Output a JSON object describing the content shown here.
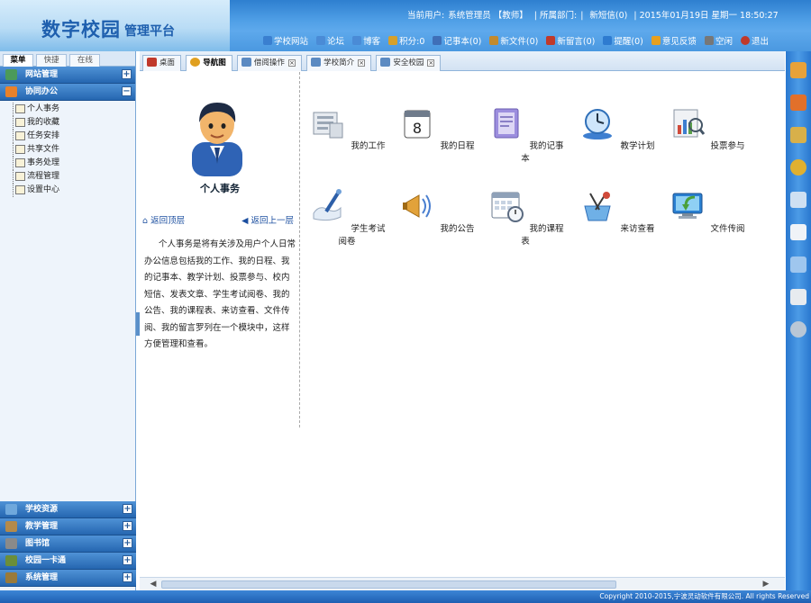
{
  "app": {
    "title_main": "数字校园",
    "title_sub": "管理平台"
  },
  "topinfo": {
    "user_label": "当前用户:",
    "user_value": "系统管理员 【教师】",
    "dept_label": "| 所属部门:",
    "dept_value": "|",
    "sms": "新短信(0)",
    "date": "| 2015年01月19日 星期一 18:50:27"
  },
  "toolbar": [
    {
      "label": "学校网站",
      "icon": "globe-icon",
      "color": "#3a7fd0"
    },
    {
      "label": "论坛",
      "icon": "forum-icon",
      "color": "#4a8bd6"
    },
    {
      "label": "博客",
      "icon": "blog-icon",
      "color": "#4a8bd6"
    },
    {
      "label": "积分:0",
      "icon": "points-icon",
      "color": "#d6a02a"
    },
    {
      "label": "记事本(0)",
      "icon": "notebook-icon",
      "color": "#3f6fb8"
    },
    {
      "label": "新文件(0)",
      "icon": "file-icon",
      "color": "#c28a2e"
    },
    {
      "label": "新留言(0)",
      "icon": "message-icon",
      "color": "#c0392b"
    },
    {
      "label": "提醒(0)",
      "icon": "reminder-icon",
      "color": "#2e7bd0"
    },
    {
      "label": "意见反馈",
      "icon": "feedback-icon",
      "color": "#e8a020"
    },
    {
      "label": "空闲",
      "icon": "status-icon",
      "color": "#777777"
    },
    {
      "label": "退出",
      "icon": "exit-icon",
      "color": "#c0392b"
    }
  ],
  "left_tabs": [
    "菜单",
    "快捷",
    "在线"
  ],
  "left_sections_top": [
    {
      "label": "网站管理",
      "icon": "website-icon",
      "color": "#4b9a5a",
      "toggle": "+"
    },
    {
      "label": "协同办公",
      "icon": "rss-icon",
      "color": "#e8812a",
      "toggle": "−"
    }
  ],
  "office_items": [
    "个人事务",
    "我的收藏",
    "任务安排",
    "共享文件",
    "事务处理",
    "流程管理",
    "设置中心"
  ],
  "left_sections_bottom": [
    {
      "label": "学校资源",
      "icon": "resource-icon",
      "color": "#6fa8dc",
      "toggle": "+"
    },
    {
      "label": "教学管理",
      "icon": "teaching-icon",
      "color": "#b48a4a",
      "toggle": "+"
    },
    {
      "label": "图书馆",
      "icon": "library-icon",
      "color": "#8a8a8a",
      "toggle": "+"
    },
    {
      "label": "校园一卡通",
      "icon": "card-icon",
      "color": "#6b8e3a",
      "toggle": "+"
    },
    {
      "label": "系统管理",
      "icon": "system-icon",
      "color": "#9a7a3a",
      "toggle": "+"
    }
  ],
  "main_tabs": [
    {
      "label": "桌面",
      "icon": "home-icon",
      "color": "#c0392b",
      "closable": false,
      "active": false
    },
    {
      "label": "导航图",
      "icon": "nav-icon",
      "color": "#e0a020",
      "closable": false,
      "active": true
    },
    {
      "label": "借阅操作",
      "icon": "borrow-icon",
      "color": "#5b8ac2",
      "closable": true,
      "active": false
    },
    {
      "label": "学校简介",
      "icon": "intro-icon",
      "color": "#5b8ac2",
      "closable": true,
      "active": false
    },
    {
      "label": "安全校园",
      "icon": "safety-icon",
      "color": "#5b8ac2",
      "closable": true,
      "active": false
    }
  ],
  "intro": {
    "title": "个人事务",
    "back_top": "返回顶层",
    "back_up": "返回上一层",
    "description": "个人事务是将有关涉及用户个人日常办公信息包括我的工作、我的日程、我的记事本、教学计划、投票参与、校内短信、发表文章、学生考试阅卷、我的公告、我的课程表、来访查看、文件传阅、我的留言罗列在一个模块中，这样方便管理和查看。"
  },
  "grid_items": [
    {
      "label": "我的工作",
      "icon": "work-icon"
    },
    {
      "label": "我的日程",
      "icon": "calendar-icon"
    },
    {
      "label": "我的记事本",
      "icon": "notepad-icon"
    },
    {
      "label": "教学计划",
      "icon": "plan-icon"
    },
    {
      "label": "投票参与",
      "icon": "vote-icon"
    },
    {
      "label": "学生考试阅卷",
      "icon": "exam-icon"
    },
    {
      "label": "我的公告",
      "icon": "announcement-icon"
    },
    {
      "label": "我的课程表",
      "icon": "schedule-icon"
    },
    {
      "label": "来访查看",
      "icon": "visit-icon"
    },
    {
      "label": "文件传阅",
      "icon": "circulate-icon"
    }
  ],
  "right_icons": [
    "books-icon",
    "eraser-icon",
    "pencil-icon",
    "key-icon",
    "user-icon",
    "document-icon",
    "download-icon",
    "printer-icon",
    "gear-icon"
  ],
  "footer": "Copyright 2010-2015,宁波灵动软件有限公司. All rights Reserved"
}
